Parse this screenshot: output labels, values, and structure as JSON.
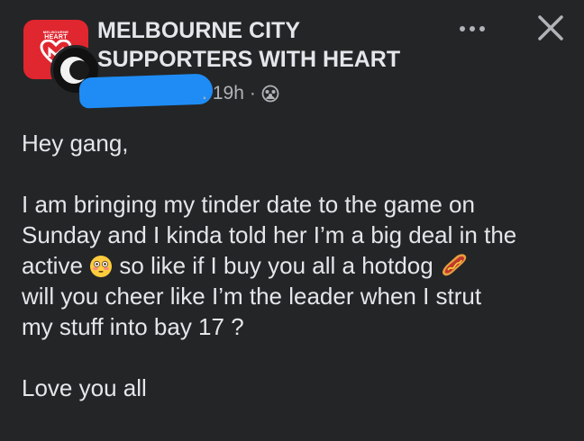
{
  "group": {
    "name": "MELBOURNE CITY SUPPORTERS WITH HEART",
    "logo_text_top": "MELBOURNE",
    "logo_text_bottom": "HEART",
    "brand_color": "#e0262f"
  },
  "post_meta": {
    "time": "19h",
    "separator": "·",
    "author_redacted": true,
    "privacy_icon": "group-members-icon"
  },
  "actions": {
    "more_icon": "more-options-icon",
    "close_icon": "close-icon"
  },
  "post": {
    "greeting": "Hey gang,",
    "line1": "I am bringing my tinder date to the game on",
    "line2": "Sunday and I kinda told her I’m a big deal in the",
    "line3a": "active",
    "line3b": "so like if I buy you all a hotdog",
    "line4": "will you cheer like I’m the leader when I strut",
    "line5": "my stuff into bay 17 ?",
    "closing": "Love you all",
    "emoji1": "flushed-face-emoji",
    "emoji2": "hotdog-emoji"
  },
  "colors": {
    "background": "#242526",
    "text": "#e4e6eb",
    "secondary_text": "#b0b3b8",
    "redaction": "#1f8cf5"
  }
}
